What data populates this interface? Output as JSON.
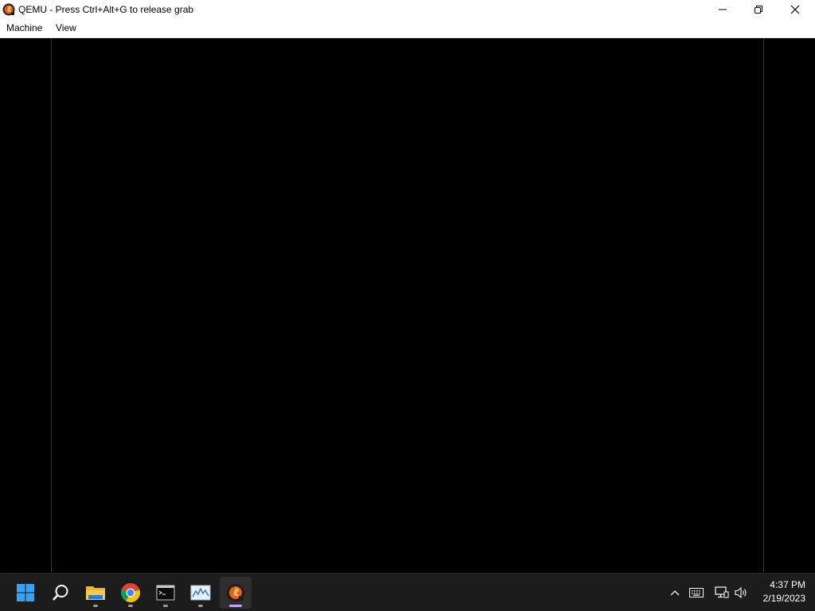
{
  "window": {
    "title": "QEMU - Press Ctrl+Alt+G to release grab",
    "app_icon": "qemu-icon"
  },
  "menubar": {
    "items": [
      {
        "label": "Machine"
      },
      {
        "label": "View"
      }
    ]
  },
  "taskbar": {
    "apps": [
      {
        "name": "start-icon"
      },
      {
        "name": "search-icon"
      },
      {
        "name": "file-explorer-icon"
      },
      {
        "name": "chrome-icon"
      },
      {
        "name": "terminal-icon"
      },
      {
        "name": "resource-monitor-icon"
      },
      {
        "name": "qemu-icon",
        "active": true
      }
    ],
    "tray": {
      "icons": [
        "chevron-up-icon",
        "keyboard-icon",
        "network-icon",
        "volume-icon"
      ],
      "time": "4:37 PM",
      "date": "2/19/2023"
    }
  },
  "colors": {
    "taskbar_bg": "#1c1c1c",
    "active_indicator": "#c9a8f0",
    "guest_bg": "#000000"
  }
}
